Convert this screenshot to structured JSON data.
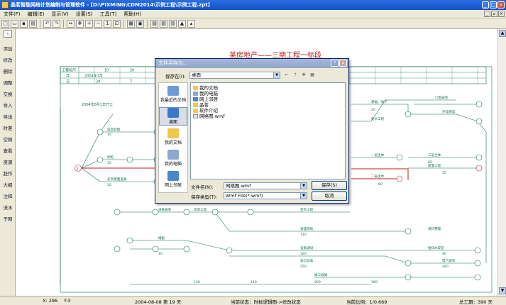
{
  "window": {
    "title": "晶茗智能网络计划编制与管理软件 - [D:\\PIXMING\\CDM2014\\示例工程\\示例工程.zpt]"
  },
  "menu": [
    "文件(F)",
    "编辑(E)",
    "显示(V)",
    "设置(S)",
    "工具(T)",
    "帮助(H)"
  ],
  "sidebar": {
    "items": [
      "添加",
      "修改",
      "删除",
      "调整",
      "交换",
      "导入",
      "导出",
      "时差",
      "空隙",
      "查看",
      "资源",
      "赶作",
      "大纲",
      "注释",
      "流水",
      "子网"
    ]
  },
  "drawing": {
    "title": "某房地产——三期工程一标段",
    "header_labels": {
      "row1": "工程标尺",
      "row2": "月",
      "row3": "日",
      "month_label": "2004年7月",
      "day_values": [
        "29",
        "7"
      ],
      "tick_labels": [
        "10",
        "20",
        "30",
        "40",
        "50",
        "60",
        "70",
        "80",
        "90",
        "100",
        "110",
        "120",
        "130",
        "140",
        "150"
      ]
    },
    "start_note": "2004年8月1日开工",
    "nodes": [
      "1",
      "3",
      "5",
      "6",
      "7",
      "13",
      "55",
      "57",
      "59",
      "60",
      "61",
      "62",
      "64",
      "66",
      "43",
      "44",
      "45",
      "48"
    ],
    "node_label": "1",
    "durations": [
      "10",
      "15",
      "10",
      "20",
      "60",
      "65",
      "40",
      "35",
      "110",
      "120",
      "130",
      "140",
      "160",
      "200",
      "250",
      "260",
      "35"
    ],
    "tasks": [
      "竖直处理",
      "阴桩",
      "安装屋面盖板",
      "基础、地下",
      "防水工程",
      "一层主体",
      "二层主体",
      "三层主体",
      "屋面工程",
      "门窗安装",
      "外墙保温",
      "设备安装",
      "装饰工程",
      "室外工程",
      "清理场地",
      "资料整理",
      "楼板",
      "设备调试",
      "给排水安装",
      "竣工验收",
      "电气安装",
      "竣工收尾"
    ]
  },
  "dialog": {
    "title": "文件另存为...",
    "save_in_label": "保存在(I):",
    "save_in_value": "桌面",
    "places": [
      "我最近的文档",
      "桌面",
      "我的文档",
      "我的电脑",
      "网上邻居"
    ],
    "files": [
      "我的文档",
      "我的电脑",
      "网上邻居",
      "晶茗",
      "软件介绍",
      "网络图.wmf"
    ],
    "filename_label": "文件名(N):",
    "filename_value": "网络图.wmf",
    "filetype_label": "保存类型(T):",
    "filetype_value": "Wmf File(*.wmf)",
    "save_button": "保存(S)",
    "cancel_button": "取消"
  },
  "status": {
    "coord_x": "X: 296",
    "coord_y": "Y:3",
    "date": "2004-08-08 第 19 天",
    "state": "当前状态：时标逻辑图->修改状态",
    "scale": "当前比例：1/0.669",
    "total_duration": "总工期：390 天"
  },
  "colors": {
    "titlebar": "#1250c8",
    "critical_path": "#c01818",
    "network_line": "#107050",
    "page_title": "#c01818"
  }
}
